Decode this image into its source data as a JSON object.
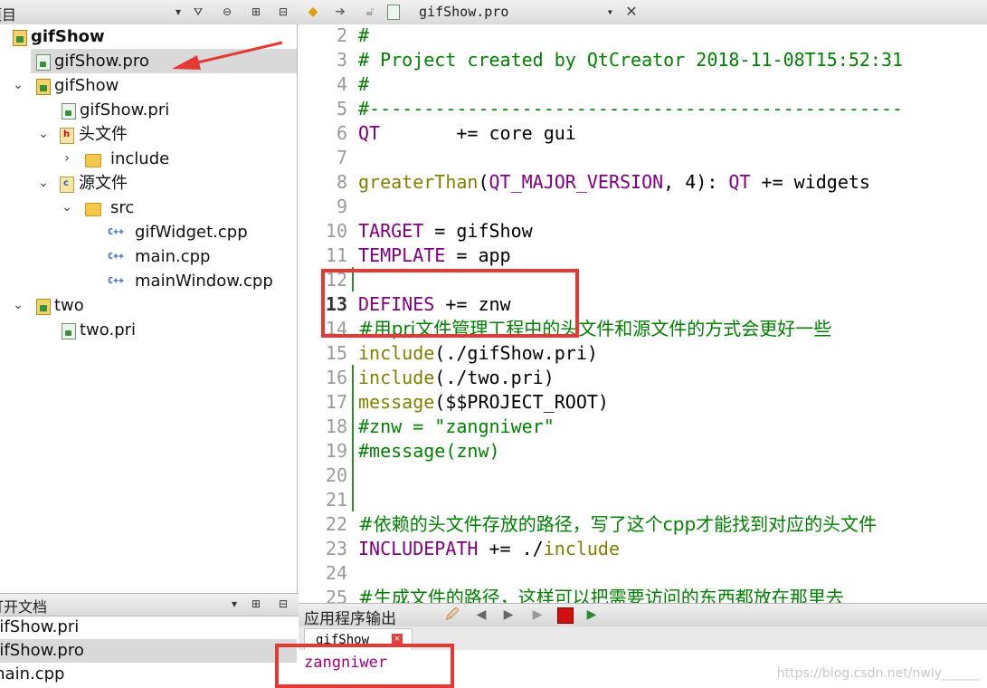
{
  "project_panel": {
    "title": "项目",
    "tree": [
      {
        "label": "gifShow",
        "icon": "project-icon",
        "bold": true
      },
      {
        "label": "gifShow.pro",
        "icon": "pro-file-icon",
        "selected": true
      },
      {
        "label": "gifShow",
        "icon": "project-icon"
      },
      {
        "label": "gifShow.pri",
        "icon": "pro-file-icon"
      },
      {
        "label": "头文件",
        "icon": "headers-folder-icon"
      },
      {
        "label": "include",
        "icon": "folder-icon"
      },
      {
        "label": "源文件",
        "icon": "sources-folder-icon"
      },
      {
        "label": "src",
        "icon": "folder-icon"
      },
      {
        "label": "gifWidget.cpp",
        "icon": "cpp-file-icon"
      },
      {
        "label": "main.cpp",
        "icon": "cpp-file-icon"
      },
      {
        "label": "mainWindow.cpp",
        "icon": "cpp-file-icon"
      },
      {
        "label": "two",
        "icon": "project-icon"
      },
      {
        "label": "two.pri",
        "icon": "pro-file-icon"
      }
    ]
  },
  "open_documents": {
    "title": "打开文档",
    "items": [
      "gifShow.pri",
      "gifShow.pro",
      "main.cpp"
    ],
    "selected_index": 1
  },
  "editor": {
    "current_file": "gifShow.pro",
    "current_line": 13,
    "lines": [
      {
        "n": "2",
        "text": "#"
      },
      {
        "n": "3",
        "text": "# Project created by QtCreator 2018-11-08T15:52:31"
      },
      {
        "n": "4",
        "text": "#"
      },
      {
        "n": "5",
        "text": "#-------------------------------------------------"
      },
      {
        "n": "6",
        "a": "QT",
        "b": "       += core gui"
      },
      {
        "n": "7",
        "text": ""
      },
      {
        "n": "8",
        "f": "greaterThan",
        "p1": "(",
        "a": "QT_MAJOR_VERSION",
        "b": ", 4): ",
        "c": "QT",
        "d": " += widgets"
      },
      {
        "n": "9",
        "text": ""
      },
      {
        "n": "10",
        "a": "TARGET",
        "b": " = gifShow"
      },
      {
        "n": "11",
        "a": "TEMPLATE",
        "b": " = app"
      },
      {
        "n": "12",
        "text": ""
      },
      {
        "n": "13",
        "a": "DEFINES",
        "b": " += znw"
      },
      {
        "n": "14",
        "text": "#用pri文件管理工程中的头文件和源文件的方式会更好一些"
      },
      {
        "n": "15",
        "f": "include",
        "b": "(./gifShow.pri)"
      },
      {
        "n": "16",
        "f": "include",
        "b": "(./two.pri)"
      },
      {
        "n": "17",
        "f": "message",
        "b": "($$PROJECT_ROOT)"
      },
      {
        "n": "18",
        "text": "#znw = \"zangniwer\""
      },
      {
        "n": "19",
        "text": "#message(znw)"
      },
      {
        "n": "20",
        "text": ""
      },
      {
        "n": "21",
        "text": ""
      },
      {
        "n": "22",
        "text": "#依赖的头文件存放的路径，写了这个cpp才能找到对应的头文件"
      },
      {
        "n": "23",
        "a": "INCLUDEPATH",
        "b": " += ./",
        "c": "include"
      },
      {
        "n": "24",
        "text": ""
      },
      {
        "n": "25",
        "text": "#生成文件的路径，这样可以把需要访问的东西都放在那里去"
      }
    ]
  },
  "output": {
    "title": "应用程序输出",
    "tab_label": "gifShow",
    "text": "zangniwer",
    "watermark": "https://blog.csdn.net/nwly______"
  },
  "colors": {
    "keyword": "#800080",
    "function": "#808000",
    "comment": "#008000",
    "output_text": "#a0007a",
    "highlight_box": "#e53935"
  }
}
